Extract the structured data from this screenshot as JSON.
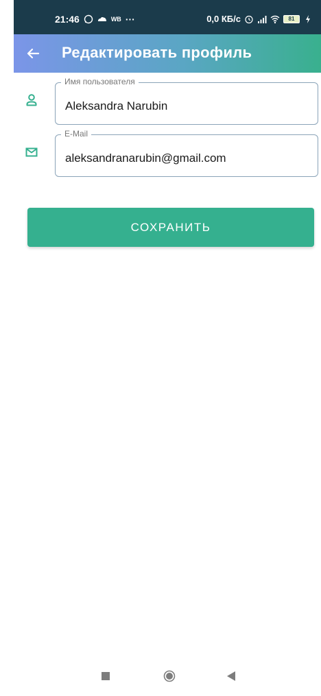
{
  "status_bar": {
    "time": "21:46",
    "wb_label": "WB",
    "more": "···",
    "net_speed": "0,0 КБ/с",
    "battery": "81",
    "icons": [
      "whatsapp-icon",
      "cloud-icon",
      "alarm-icon",
      "signal-icon",
      "wifi-icon",
      "battery-icon",
      "charging-icon"
    ]
  },
  "app_bar": {
    "title": "Редактировать профиль",
    "back_icon": "arrow-left-icon"
  },
  "form": {
    "username": {
      "label": "Имя пользователя",
      "value": "Aleksandra Narubin",
      "icon": "person-icon"
    },
    "email": {
      "label": "E-Mail",
      "value": "aleksandranarubin@gmail.com",
      "icon": "mail-icon"
    },
    "save_label": "СОХРАНИТЬ"
  },
  "nav_bar": {
    "icons": [
      "recents-square-icon",
      "home-circle-icon",
      "back-triangle-icon"
    ]
  },
  "colors": {
    "accent": "#35b08f",
    "status_bar": "#1b3b4b",
    "app_bar_gradient": [
      "#7b95e8",
      "#39b08e"
    ],
    "field_border": "#8aa3b8"
  }
}
